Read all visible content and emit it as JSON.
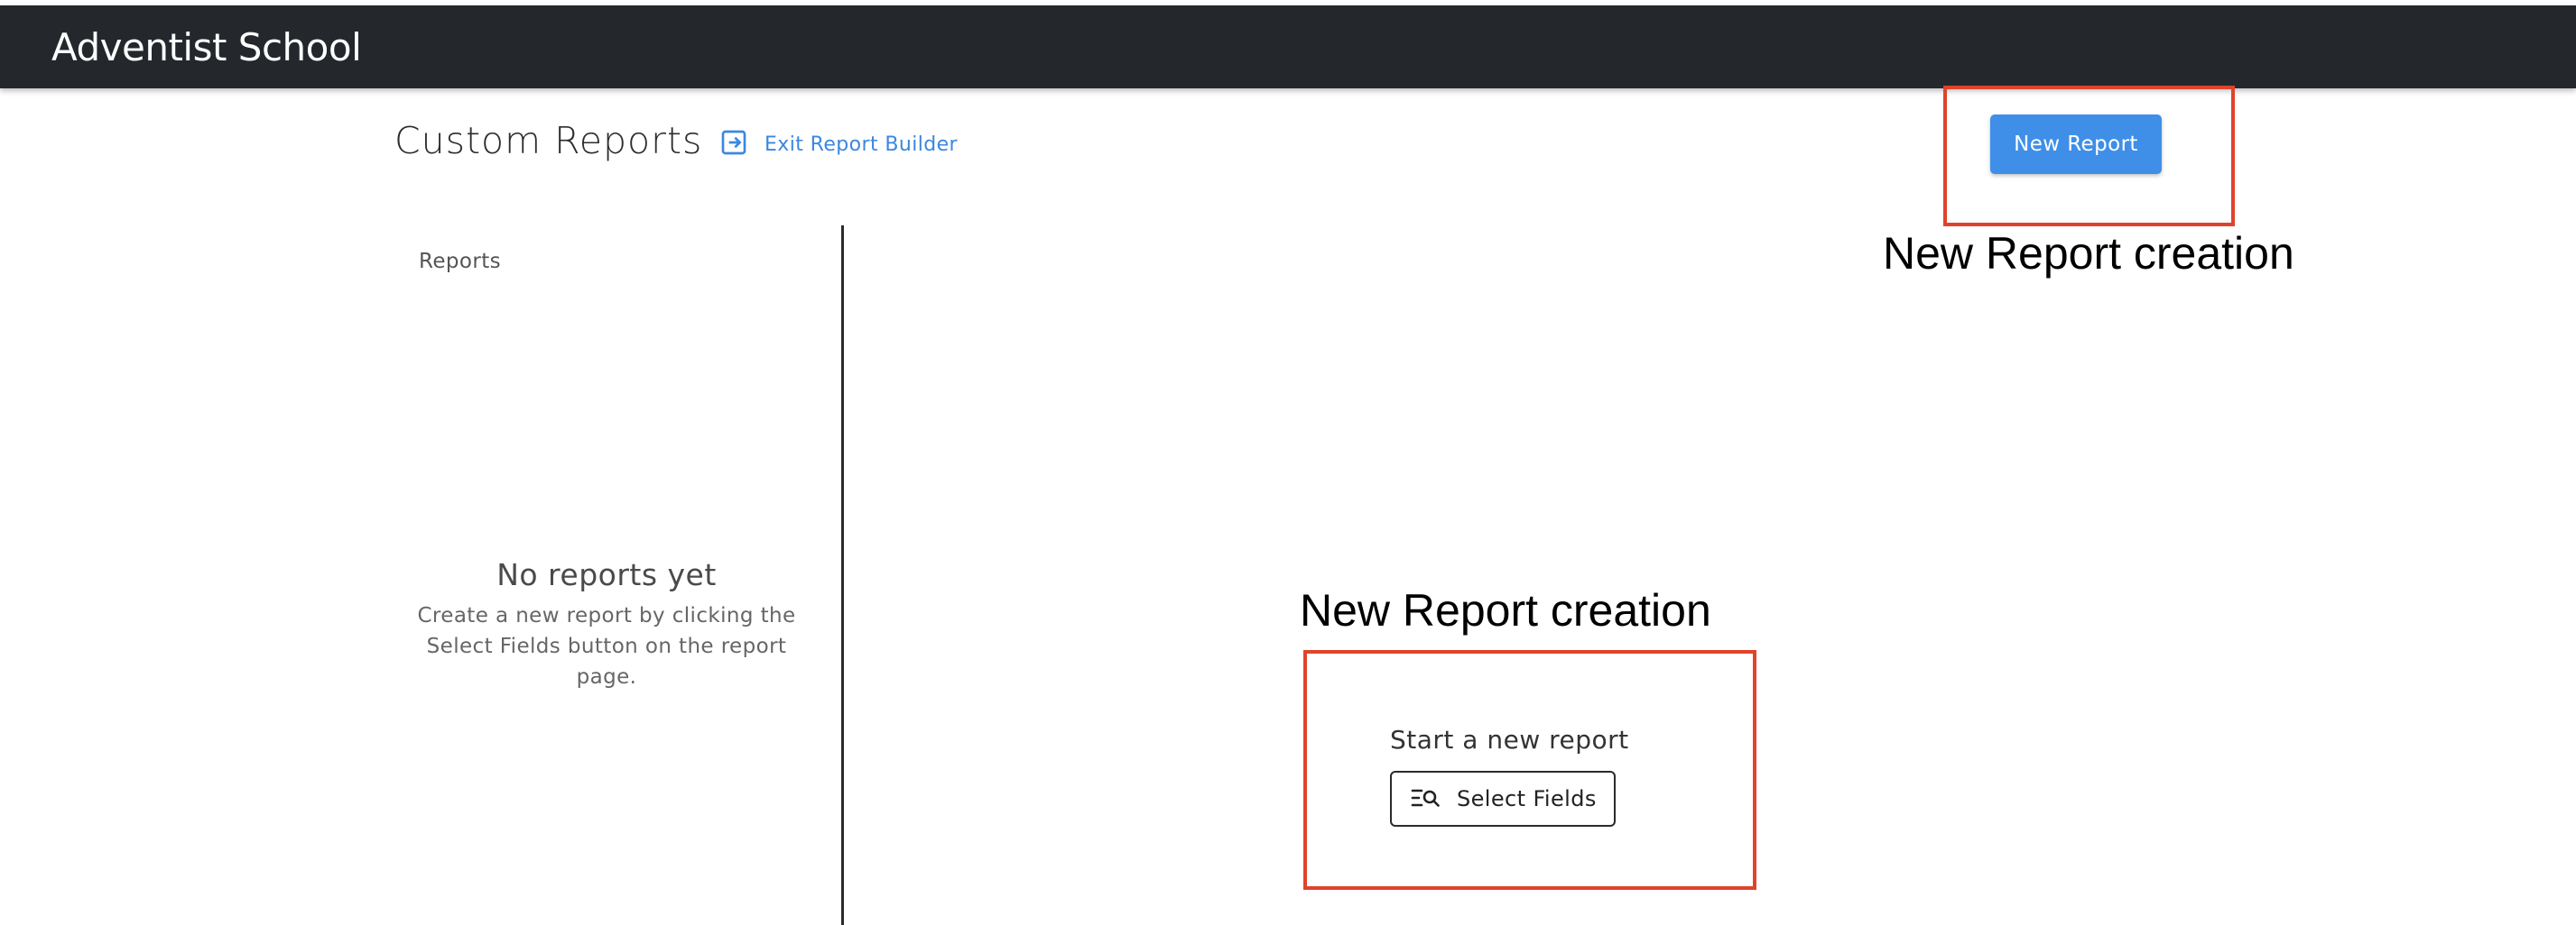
{
  "app": {
    "title": "Adventist School"
  },
  "header": {
    "page_title": "Custom Reports",
    "exit_link_label": "Exit Report Builder",
    "new_report_label": "New Report"
  },
  "sidebar": {
    "heading": "Reports",
    "empty_title": "No reports yet",
    "empty_description": "Create a new report by clicking the Select Fields button on the report page."
  },
  "main": {
    "start_label": "Start a new report",
    "select_fields_label": "Select Fields"
  },
  "annotations": [
    {
      "text": "New Report creation"
    },
    {
      "text": "New Report creation"
    }
  ],
  "colors": {
    "topbar": "#24282d",
    "accent": "#3f8fe8",
    "link": "#3b87e0",
    "annotation": "#e0432c"
  },
  "icons": {
    "exit": "exit-icon",
    "select_fields": "list-search-icon"
  }
}
